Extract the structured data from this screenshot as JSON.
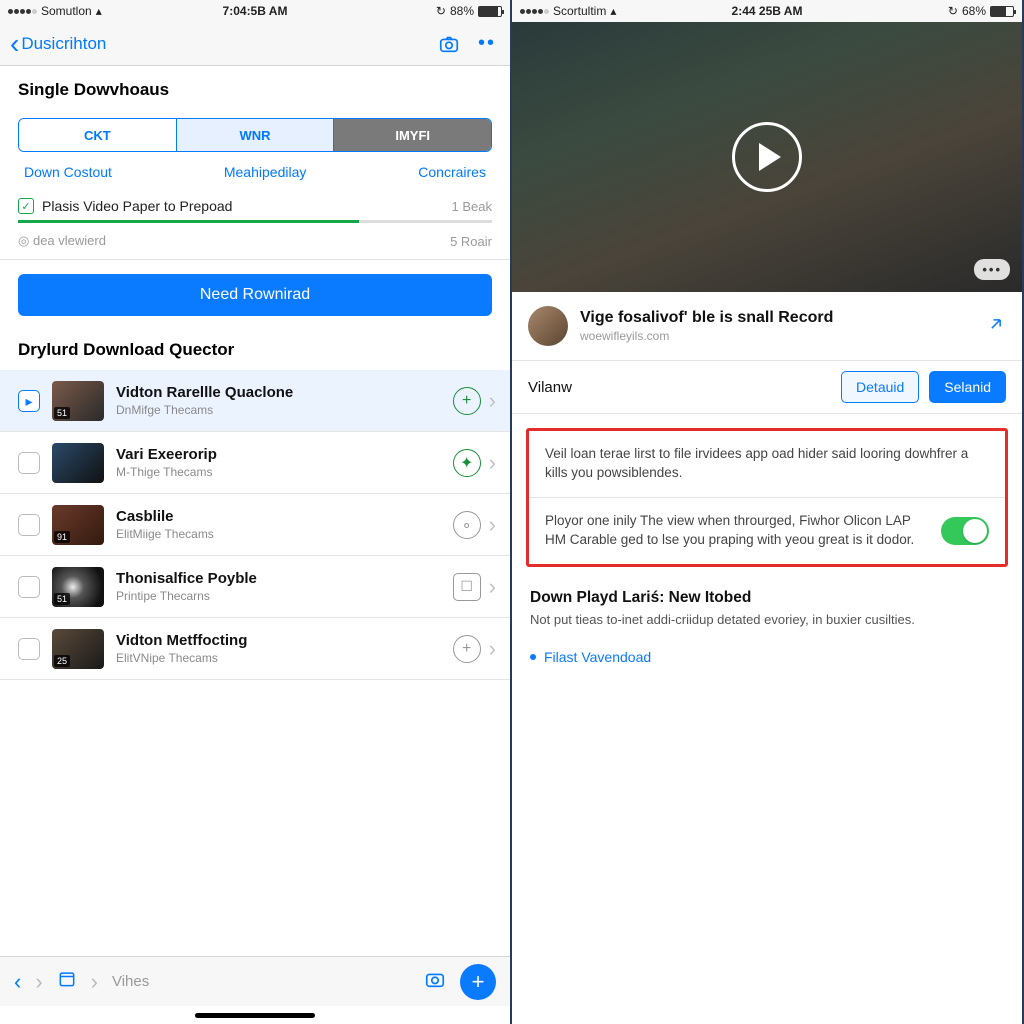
{
  "left": {
    "status": {
      "carrier": "Somutlon",
      "time": "7:04:5B AM",
      "battery_pct": "88%",
      "battery_fill": 88
    },
    "nav": {
      "back_label": "Dusicrihton"
    },
    "section1_title": "Single Dowvhoaus",
    "seg": {
      "a": "CKT",
      "b": "WNR",
      "c": "IMYFI"
    },
    "links": {
      "a": "Down Costout",
      "b": "Meahipedilay",
      "c": "Concraires"
    },
    "progress": {
      "label": "Plasis Video Paper to Prepoad",
      "right": "1 Beak",
      "sub_left": "dea vlewierd",
      "sub_right": "5 Roair",
      "pct": 72
    },
    "primary_button": "Need Rownirad",
    "queue_header": "Drylurd Download Quector",
    "items": [
      {
        "checked": true,
        "selected": true,
        "title": "Vidton Rarellle Quaclone",
        "sub": "DnMifge Thecams",
        "badge": "51",
        "icon": "plus-green"
      },
      {
        "checked": false,
        "selected": false,
        "title": "Vari Exeerorip",
        "sub": "M-Thige Thecams",
        "badge": "",
        "icon": "plus-green"
      },
      {
        "checked": false,
        "selected": false,
        "title": "Casblile",
        "sub": "ElitMiige Thecams",
        "badge": "91",
        "icon": "info-gray"
      },
      {
        "checked": false,
        "selected": false,
        "title": "Thonisalfice Poyble",
        "sub": "Printipe Thecarns",
        "badge": "51",
        "icon": "archive-gray"
      },
      {
        "checked": false,
        "selected": false,
        "title": "Vidton Metffocting",
        "sub": "ElitVNipe Thecams",
        "badge": "25",
        "icon": "plus-gray"
      }
    ],
    "toolbar_hint": "Vihes"
  },
  "right": {
    "status": {
      "carrier": "Scortultim",
      "time": "2:44 25B AM",
      "battery_pct": "68%",
      "battery_fill": 68
    },
    "video": {
      "title": "Vige fosalivof' ble is snall Record",
      "site": "woewifleyils.com"
    },
    "action": {
      "label": "Vilanw",
      "btn1": "Detauid",
      "btn2": "Selanid"
    },
    "frame": {
      "para1": "Veil loan terae lirst to file irvidees app oad hider said looring dowhfrer a kills you powsiblendes.",
      "para2": "Ployor one inily The view when throurged, Fiwhor Olicon LAP HM Carable ged to lse you praping with yeou great is it dodor."
    },
    "section": {
      "heading": "Down Playd Lariś: New Itobed",
      "body": "Not put tieas to-inet addi-criidup detated evoriey, in buxier cusilties.",
      "link": "Filast Vavendoad"
    }
  }
}
